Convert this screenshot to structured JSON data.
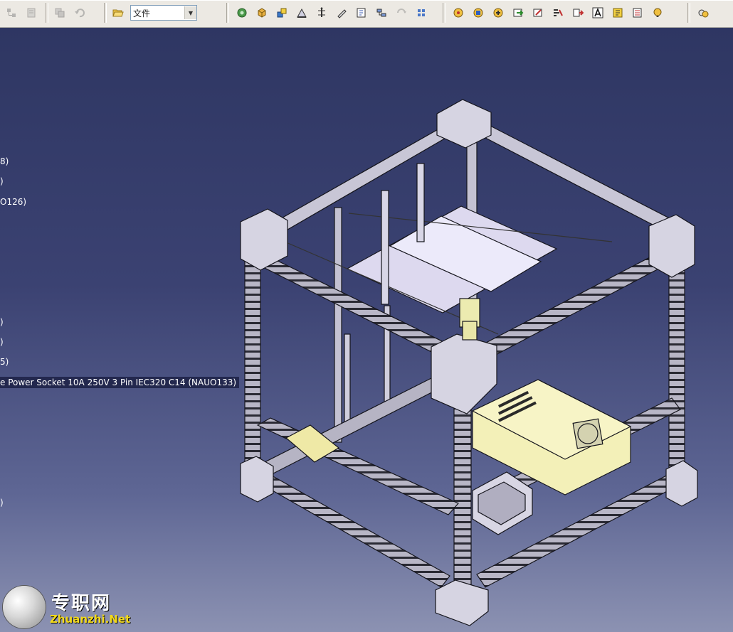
{
  "toolbar": {
    "buttons_left": [
      {
        "icon": "product-structure-icon",
        "disabled": true
      },
      {
        "icon": "catalog-icon",
        "disabled": true
      },
      {
        "icon": "copy-icon",
        "disabled": true
      },
      {
        "icon": "undo-icon",
        "disabled": true
      }
    ],
    "open_icon": "folder-icon",
    "file_select": {
      "value": "文件"
    },
    "buttons_middle": [
      {
        "icon": "new-component-icon"
      },
      {
        "icon": "new-product-icon"
      },
      {
        "icon": "new-part-icon"
      },
      {
        "icon": "existing-component-icon"
      },
      {
        "icon": "replace-component-icon"
      },
      {
        "icon": "graph-tree-icon"
      },
      {
        "icon": "generate-numbering-icon"
      },
      {
        "icon": "selective-load-icon"
      },
      {
        "icon": "manage-representations-icon",
        "disabled": true
      },
      {
        "icon": "multi-instantiation-icon"
      }
    ],
    "buttons_right": [
      {
        "icon": "update-icon"
      },
      {
        "icon": "constraint-icon"
      },
      {
        "icon": "fix-icon"
      },
      {
        "icon": "move-icon"
      },
      {
        "icon": "snap-icon"
      },
      {
        "icon": "explode-icon"
      },
      {
        "icon": "stop-manipulate-icon"
      },
      {
        "icon": "annotation-text-icon"
      },
      {
        "icon": "flag-note-icon"
      },
      {
        "icon": "measure-icon"
      },
      {
        "icon": "more-options-icon"
      }
    ],
    "buttons_far": [
      {
        "icon": "space-analysis-icon"
      }
    ]
  },
  "tree": [
    {
      "label": "8)"
    },
    {
      "label": ")"
    },
    {
      "label": "O126)"
    },
    {
      "label": ")"
    },
    {
      "label": ")"
    },
    {
      "label": "5)"
    },
    {
      "label": "e Power Socket 10A 250V 3 Pin IEC320 C14 (NAUO133)"
    },
    {
      "label": ")"
    }
  ],
  "watermark": {
    "cn": "专职网",
    "en": "Zhuanzhi.Net"
  },
  "colors": {
    "background_top": "#2d3561",
    "background_bottom": "#8c92b2",
    "model_metal": "#d2d0dc",
    "model_edges": "#1a1a22",
    "power_supply": "#f3f0b8"
  }
}
